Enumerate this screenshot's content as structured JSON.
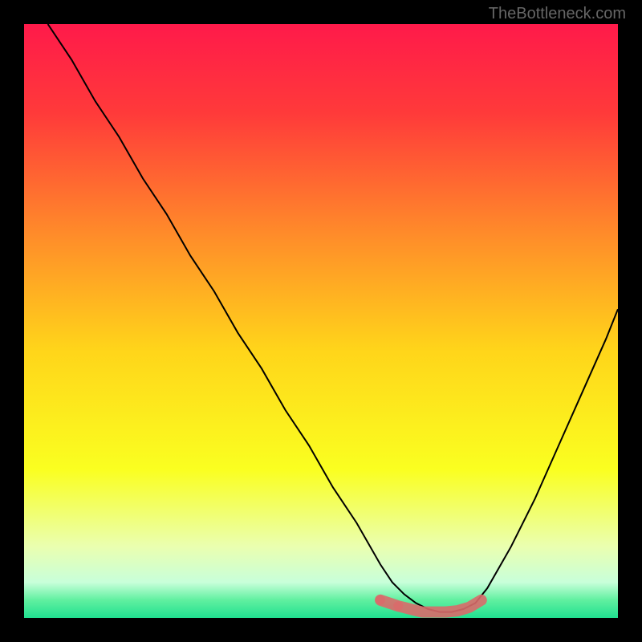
{
  "watermark": "TheBottleneck.com",
  "chart_data": {
    "type": "line",
    "title": "",
    "xlabel": "",
    "ylabel": "",
    "xlim": [
      0,
      100
    ],
    "ylim": [
      0,
      100
    ],
    "background_gradient": {
      "stops": [
        {
          "offset": 0.0,
          "color": "#ff1a4a"
        },
        {
          "offset": 0.15,
          "color": "#ff3a3a"
        },
        {
          "offset": 0.35,
          "color": "#ff8a2a"
        },
        {
          "offset": 0.55,
          "color": "#ffd51a"
        },
        {
          "offset": 0.75,
          "color": "#faff20"
        },
        {
          "offset": 0.88,
          "color": "#eaffb0"
        },
        {
          "offset": 0.94,
          "color": "#c8ffda"
        },
        {
          "offset": 0.97,
          "color": "#60f0a0"
        },
        {
          "offset": 1.0,
          "color": "#20e090"
        }
      ]
    },
    "series": [
      {
        "name": "bottleneck-curve",
        "color": "#000000",
        "width": 2,
        "x": [
          4,
          8,
          12,
          16,
          20,
          24,
          28,
          32,
          36,
          40,
          44,
          48,
          52,
          56,
          60,
          62,
          64,
          66,
          68,
          70,
          72,
          74,
          76,
          78,
          82,
          86,
          90,
          94,
          98,
          100
        ],
        "y": [
          100,
          94,
          87,
          81,
          74,
          68,
          61,
          55,
          48,
          42,
          35,
          29,
          22,
          16,
          9,
          6,
          4,
          2.5,
          1.5,
          1,
          1,
          1.5,
          2.5,
          5,
          12,
          20,
          29,
          38,
          47,
          52
        ]
      },
      {
        "name": "optimal-marker",
        "type": "scatter",
        "color": "#d96a6a",
        "marker_size": 10,
        "x": [
          60,
          63,
          65,
          67,
          69,
          71,
          73,
          75,
          77
        ],
        "y": [
          3,
          2,
          1.5,
          1,
          1,
          1,
          1.2,
          1.8,
          3
        ]
      }
    ]
  }
}
